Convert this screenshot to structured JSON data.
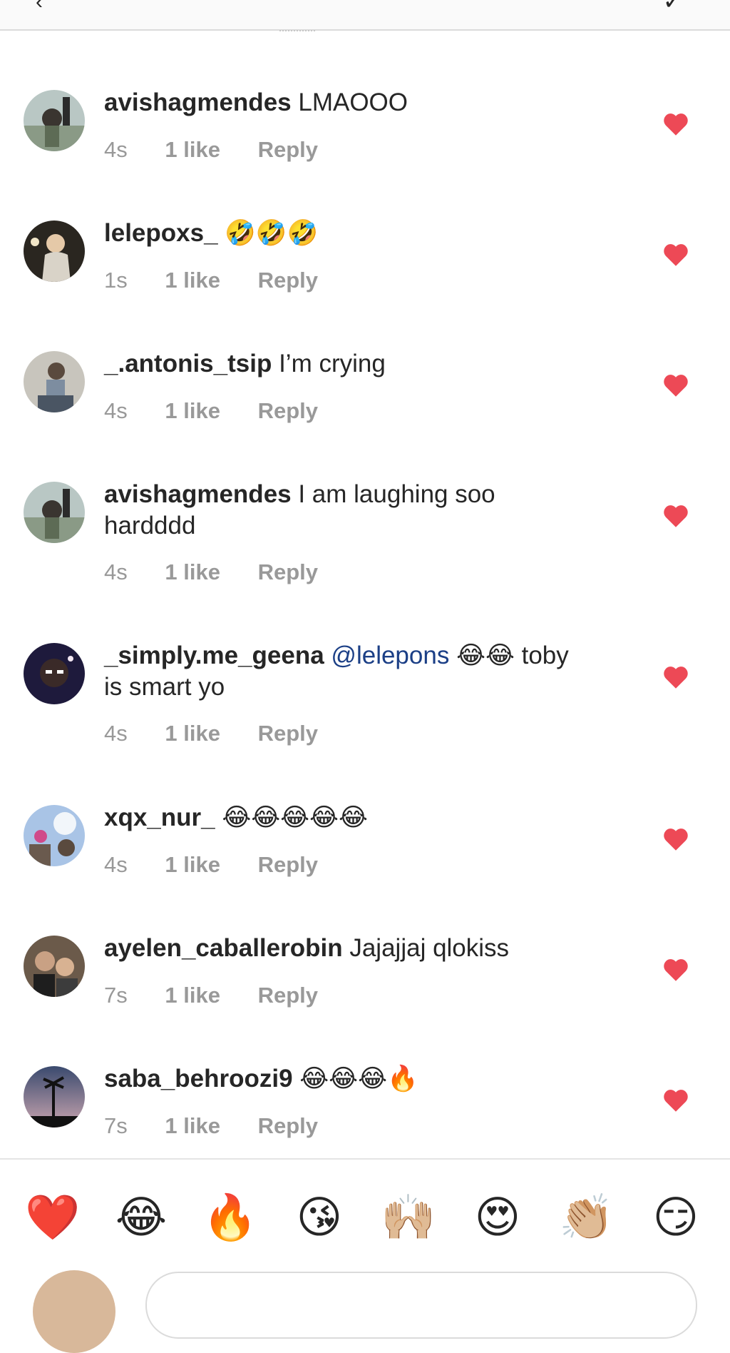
{
  "header": {
    "back_icon": "‹",
    "share_icon": "✓"
  },
  "comments": [
    {
      "username": "avishagmendes",
      "text": "LMAOOO",
      "time": "4s",
      "likes": "1 like",
      "reply": "Reply"
    },
    {
      "username": "lelepoxs_",
      "text": "🤣🤣🤣",
      "time": "1s",
      "likes": "1 like",
      "reply": "Reply"
    },
    {
      "username": "_.antonis_tsip",
      "text": "I’m crying",
      "time": "4s",
      "likes": "1 like",
      "reply": "Reply"
    },
    {
      "username": "avishagmendes",
      "text": "I am laughing soo hardddd",
      "time": "4s",
      "likes": "1 like",
      "reply": "Reply"
    },
    {
      "username": "_simply.me_geena",
      "mention": "@lelepons",
      "text": "😂😂 toby is smart yo",
      "time": "4s",
      "likes": "1 like",
      "reply": "Reply"
    },
    {
      "username": "xqx_nur_",
      "text": "😂😂😂😂😂",
      "time": "4s",
      "likes": "1 like",
      "reply": "Reply"
    },
    {
      "username": "ayelen_caballerobin",
      "text": "Jajajjaj qlokiss",
      "time": "7s",
      "likes": "1 like",
      "reply": "Reply"
    },
    {
      "username": "saba_behroozi9",
      "text": "😂😂😂🔥",
      "time": "7s",
      "likes": "1 like",
      "reply": "Reply"
    }
  ],
  "emoji_bar": [
    "❤️",
    "😂",
    "🔥",
    "😘",
    "🙌🏼",
    "😍",
    "👏🏼",
    "😏"
  ],
  "colors": {
    "heart": "#ed4956",
    "meta": "#999999",
    "mention": "#1b3f86"
  }
}
